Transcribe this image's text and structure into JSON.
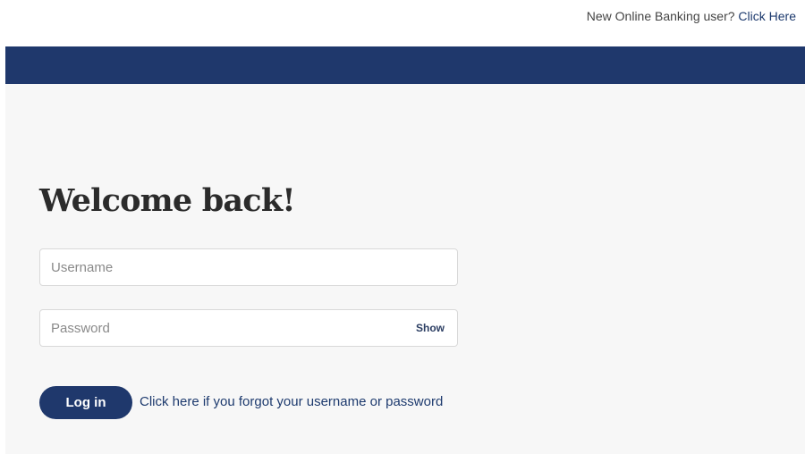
{
  "header": {
    "new_user_text": "New Online Banking user?",
    "new_user_link": "Click Here"
  },
  "login": {
    "heading": "Welcome back!",
    "username_placeholder": "Username",
    "password_placeholder": "Password",
    "show_label": "Show",
    "login_button": "Log in",
    "forgot_link": "Click here if you forgot your username or password"
  },
  "colors": {
    "brand_navy": "#1f386c",
    "link": "#1d3a6e",
    "background": "#f7f7f7"
  }
}
